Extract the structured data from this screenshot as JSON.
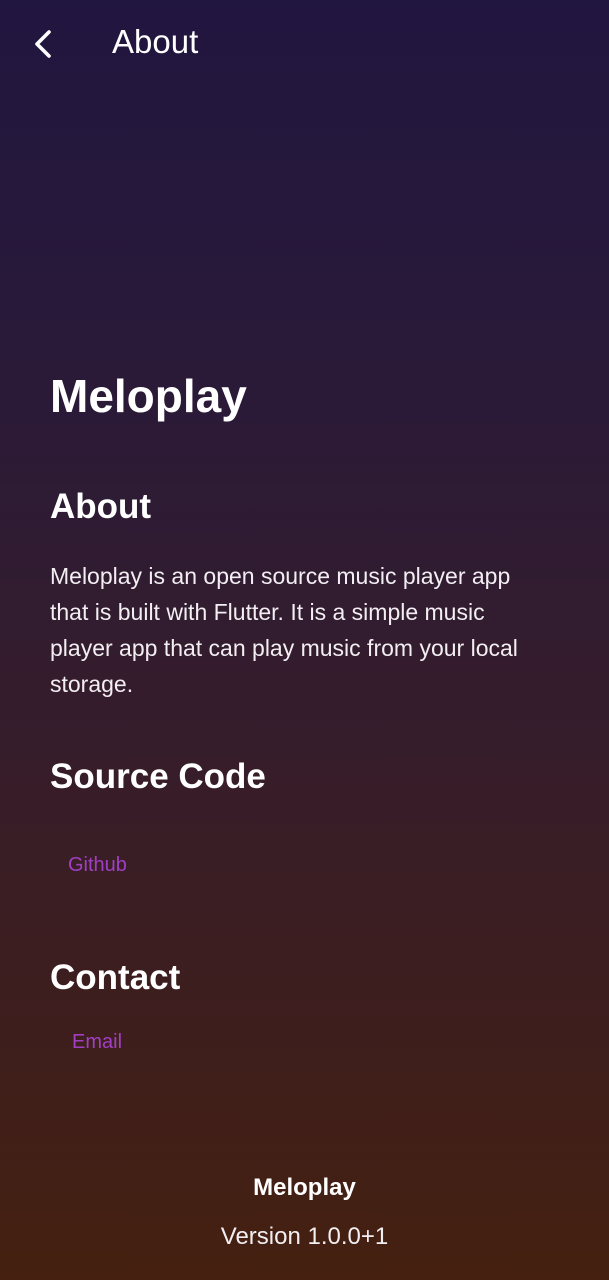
{
  "appbar": {
    "title": "About",
    "back_icon": "chevron-left-icon"
  },
  "logo": {
    "icon": "sound-wave-icon",
    "gradient_top": "#1de0d0",
    "gradient_bottom": "#10a8e8"
  },
  "content": {
    "app_name": "Meloplay",
    "about_heading": "About",
    "about_text": "Meloplay is an open source music player app that is built with Flutter. It is a simple music player app that can play music from your local storage.",
    "source_heading": "Source Code",
    "github_label": "Github",
    "contact_heading": "Contact",
    "email_label": "Email"
  },
  "footer": {
    "app_name": "Meloplay",
    "version": "Version 1.0.0+1"
  },
  "colors": {
    "link": "#a13fc4",
    "background_top": "#211640",
    "background_bottom": "#452010"
  }
}
